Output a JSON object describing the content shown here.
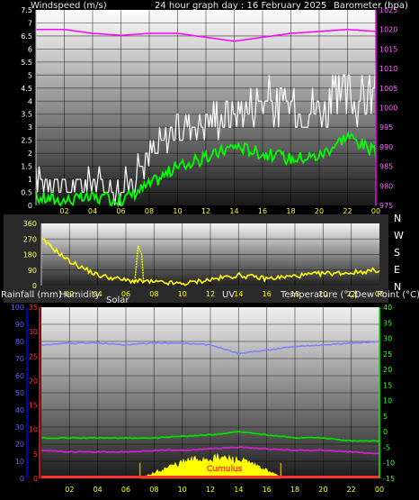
{
  "panel1": {
    "left_title": "Windspeed (m/s)",
    "center_title": "24 hour graph day : 16 February 2025",
    "right_title": "Barometer (hpa)",
    "left_ticks": [
      "7.5",
      "7",
      "6.5",
      "6",
      "5.5",
      "5",
      "4.5",
      "4",
      "3.5",
      "3",
      "2.5",
      "2",
      "1.5",
      "1",
      "0.5",
      "0"
    ],
    "right_ticks": [
      "1025",
      "1020",
      "1015",
      "1010",
      "1005",
      "1000",
      "995",
      "990",
      "985",
      "980",
      "975"
    ],
    "x_ticks": [
      "02",
      "04",
      "06",
      "08",
      "10",
      "12",
      "14",
      "16",
      "18",
      "20",
      "22",
      "00"
    ]
  },
  "panel2": {
    "left_ticks": [
      "360",
      "270",
      "180",
      "90",
      "0"
    ],
    "compass": [
      "N",
      "W",
      "S",
      "E",
      "N"
    ],
    "x_ticks": [
      "02",
      "04",
      "06",
      "08",
      "10",
      "12",
      "14",
      "16",
      "18",
      "20",
      "22",
      "00"
    ]
  },
  "panel3": {
    "labels": {
      "rain": "Rainfall (mm)",
      "humidity": "Humidity",
      "solar": "Solar",
      "uv": "UV",
      "temperature": "Temperature (°C)",
      "dewpoint": "Dew Point (°C)"
    },
    "humidity_ticks": [
      "100",
      "90",
      "80",
      "70",
      "60",
      "50",
      "40",
      "30",
      "20",
      "10",
      "0"
    ],
    "rain_ticks": [
      "35",
      "30",
      "25",
      "20",
      "15",
      "10",
      "5",
      "0"
    ],
    "temp_ticks": [
      "40",
      "35",
      "30",
      "25",
      "20",
      "15",
      "10",
      "5",
      "0",
      "-5",
      "-10",
      "-15"
    ],
    "x_ticks": [
      "02",
      "04",
      "06",
      "08",
      "10",
      "12",
      "14",
      "16",
      "18",
      "20",
      "22",
      "00"
    ],
    "watermark": "Cumulus"
  },
  "colors": {
    "wind": "#d8d8d8",
    "gust": "#ffffff",
    "wind_avg": "#00ff00",
    "barometer": "#ff00ff",
    "direction": "#ffff00",
    "humidity": "#8080ff",
    "temperature": "#00e000",
    "dewpoint": "#d020d0",
    "solar": "#ffff00",
    "rain": "#ff3030",
    "axis_left": "#0000ff",
    "axis_right": "#00ff00",
    "axis_red": "#ff2020",
    "axis_magenta": "#ff00ff"
  },
  "chart_data": [
    {
      "type": "line",
      "title": "24 hour graph day : 16 February 2025",
      "xlabel": "",
      "x": [
        "00",
        "02",
        "04",
        "06",
        "08",
        "10",
        "12",
        "14",
        "16",
        "18",
        "20",
        "22",
        "00"
      ],
      "ylabel": "Windspeed (m/s)",
      "ylim": [
        0,
        7.5
      ],
      "y2label": "Barometer (hpa)",
      "y2lim": [
        975,
        1025
      ],
      "series": [
        {
          "axis": "left",
          "values": [
            0.9,
            0.6,
            0.7,
            0.4,
            1.6,
            2.7,
            3.0,
            3.3,
            3.7,
            3.4,
            3.3,
            3.7,
            3.8
          ]
        },
        {
          "axis": "left",
          "values": [
            0.3,
            0.2,
            0.3,
            0.2,
            0.8,
            1.5,
            1.8,
            2.3,
            2.0,
            1.8,
            1.9,
            2.7,
            2.0
          ]
        },
        {
          "axis": "right",
          "values": [
            1020.0,
            1020.0,
            1019.0,
            1018.5,
            1019.0,
            1019.0,
            1018.0,
            1017.0,
            1018.0,
            1019.0,
            1019.5,
            1020.0,
            1019.5
          ]
        }
      ],
      "grid": true
    },
    {
      "type": "line",
      "title": "",
      "x": [
        "00",
        "02",
        "04",
        "06",
        "08",
        "10",
        "12",
        "14",
        "16",
        "18",
        "20",
        "22",
        "00"
      ],
      "ylabel": "",
      "ylim": [
        0,
        360
      ],
      "series": [
        {
          "values": [
            270,
            140,
            60,
            30,
            20,
            10,
            35,
            60,
            40,
            55,
            70,
            75,
            90
          ]
        }
      ],
      "grid": true
    },
    {
      "type": "line",
      "title": "",
      "x": [
        "00",
        "02",
        "04",
        "06",
        "08",
        "10",
        "12",
        "14",
        "16",
        "18",
        "20",
        "22",
        "00"
      ],
      "ylabel": "Humidity",
      "ylim": [
        0,
        100
      ],
      "y2label": "Temperature (°C)",
      "y2lim": [
        -15,
        40
      ],
      "series": [
        {
          "name": "Humidity",
          "axis": "left",
          "values": [
            78,
            79,
            79,
            78,
            79,
            79,
            78,
            73,
            75,
            77,
            78,
            79,
            80
          ]
        },
        {
          "name": "Temperature (°C)",
          "axis": "right",
          "values": [
            -2,
            -2,
            -2,
            -2,
            -2,
            -1.5,
            -1,
            0,
            -1,
            -2,
            -2,
            -3,
            -3
          ]
        },
        {
          "name": "Dew Point (°C)",
          "axis": "right",
          "values": [
            -6,
            -6.5,
            -6.5,
            -6.5,
            -6,
            -6,
            -5.5,
            -5,
            -5.5,
            -6,
            -6,
            -6.5,
            -7
          ]
        },
        {
          "name": "Solar",
          "axis": "left",
          "values": [
            0,
            0,
            0,
            0,
            0,
            5,
            8,
            12,
            8,
            0,
            0,
            0,
            0
          ]
        },
        {
          "name": "Rainfall (mm)",
          "axis": "left",
          "values": [
            0,
            0,
            0,
            0,
            0,
            0,
            0,
            0,
            0,
            0,
            0,
            0,
            0
          ]
        }
      ],
      "grid": true
    }
  ]
}
